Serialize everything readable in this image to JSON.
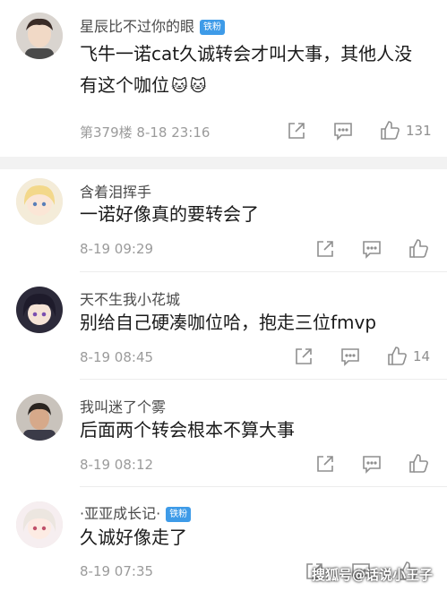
{
  "comments": [
    {
      "username": "星辰比不过你的眼",
      "badge": "铁粉",
      "text_line1": "飞牛一诺cat久诚转会才叫大事，其他人没",
      "text_line2": "有这个咖位",
      "emoji": "🐱",
      "meta": "第379楼  8-18 23:16",
      "likes": "131"
    },
    {
      "username": "含着泪挥手",
      "text": "一诺好像真的要转会了",
      "meta": "8-19 09:29"
    },
    {
      "username": "天不生我小花城",
      "text": "别给自己硬凑咖位哈，抱走三位fmvp",
      "meta": "8-19 08:45",
      "likes": "14"
    },
    {
      "username": "我叫迷了个雾",
      "text": "后面两个转会根本不算大事",
      "meta": "8-19 08:12"
    },
    {
      "username": "·亚亚成长记·",
      "badge": "铁粉",
      "text": "久诚好像走了",
      "meta": "8-19 07:35"
    }
  ],
  "watermark": "搜狐号@话说小王子",
  "colors": {
    "badge": "#3e9be8",
    "text": "#1a1a1a",
    "muted": "#9b9b9b"
  },
  "icons": [
    "share-icon",
    "comment-icon",
    "thumbs-up-icon"
  ]
}
